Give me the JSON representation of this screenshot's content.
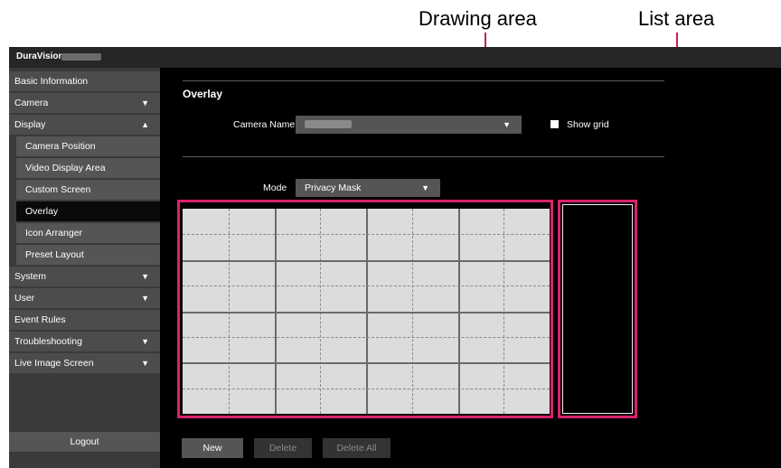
{
  "callouts": {
    "drawing_area": "Drawing area",
    "list_area": "List area"
  },
  "app": {
    "brand": "DuraVision"
  },
  "sidebar": {
    "items": [
      {
        "label": "Basic Information",
        "arrow": ""
      },
      {
        "label": "Camera",
        "arrow": "▼"
      },
      {
        "label": "Display",
        "arrow": "▲"
      },
      {
        "label": "Camera Position",
        "arrow": ""
      },
      {
        "label": "Video Display Area",
        "arrow": ""
      },
      {
        "label": "Custom Screen",
        "arrow": ""
      },
      {
        "label": "Overlay",
        "arrow": ""
      },
      {
        "label": "Icon Arranger",
        "arrow": ""
      },
      {
        "label": "Preset Layout",
        "arrow": ""
      },
      {
        "label": "System",
        "arrow": "▼"
      },
      {
        "label": "User",
        "arrow": "▼"
      },
      {
        "label": "Event Rules",
        "arrow": ""
      },
      {
        "label": "Troubleshooting",
        "arrow": "▼"
      },
      {
        "label": "Live Image Screen",
        "arrow": "▼"
      }
    ],
    "active": "Overlay",
    "logout": "Logout"
  },
  "main": {
    "title": "Overlay",
    "camera_name_label": "Camera Name",
    "camera_select_arrow": "▼",
    "show_grid_label": "Show grid",
    "mode_label": "Mode",
    "mode_value": "Privacy Mask",
    "mode_arrow": "▼"
  },
  "buttons": {
    "new": "New",
    "delete": "Delete",
    "delete_all": "Delete All"
  },
  "colors": {
    "highlight": "#d9226b",
    "panel": "#000000",
    "sidebar_item": "#4c4c4c"
  }
}
